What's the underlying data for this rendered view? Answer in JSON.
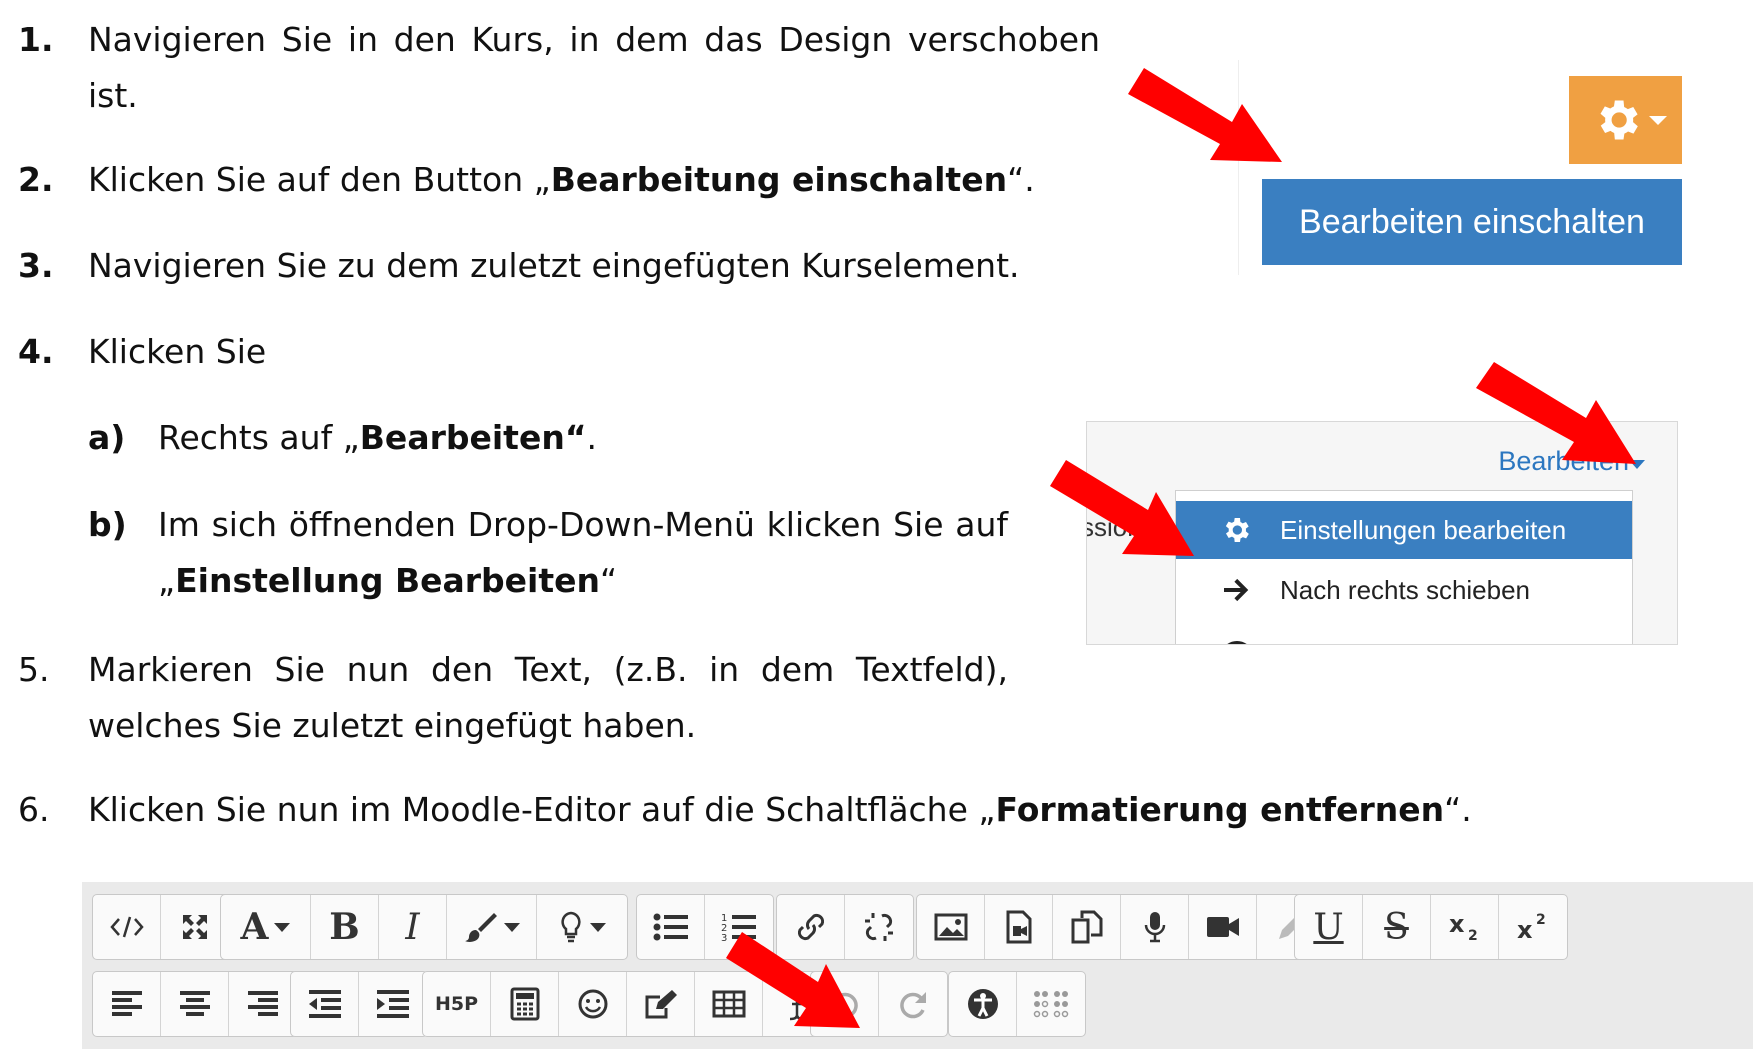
{
  "steps": [
    {
      "num": "1.",
      "text": "Navigieren Sie in den Kurs, in dem das Design verschoben ist."
    },
    {
      "num": "2.",
      "pre": "Klicken Sie auf den Button „",
      "bold": "Bearbeitung einschalten",
      "post": "“."
    },
    {
      "num": "3.",
      "text": "Navigieren Sie zu dem zuletzt eingefügten Kurselement."
    },
    {
      "num": "4.",
      "text": "Klicken Sie"
    },
    {
      "num": "a)",
      "pre": "Rechts auf „",
      "bold": "Bearbeiten“",
      "post": "."
    },
    {
      "num": "b)",
      "pre": "Im sich öffnenden Drop-Down-Menü klicken Sie auf „",
      "bold": "Einstellung Bearbeiten",
      "post": "“"
    },
    {
      "num": "5.",
      "text": "Markieren Sie nun den Text, (z.B. in dem Textfeld), welches Sie zuletzt eingefügt haben."
    },
    {
      "num": "6.",
      "pre": "Klicken Sie nun im Moodle-Editor auf die Schaltfläche „",
      "bold": "Formatierung entfernen",
      "post": "“."
    }
  ],
  "screenshot1": {
    "edit_button_label": "Bearbeiten einschalten",
    "gear_icon": "gear-icon",
    "colors": {
      "gear_bg": "#f0a042",
      "button_bg": "#3a7fc1"
    }
  },
  "screenshot2": {
    "link_label": "Bearbeiten",
    "partial_text": "ssion.",
    "menu_items": [
      {
        "label": "Einstellungen bearbeiten",
        "icon": "gear-icon",
        "active": true
      },
      {
        "label": "Nach rechts schieben",
        "icon": "arrow-right-icon",
        "active": false
      }
    ],
    "colors": {
      "link": "#2c77c0",
      "active_bg": "#3a7fc1"
    }
  },
  "toolbar": {
    "row1_groups": [
      [
        "html-icon",
        "fullscreen-icon"
      ],
      [
        "font-icon",
        "bold-icon",
        "italic-icon",
        "brush-icon",
        "lightbulb-icon"
      ],
      [
        "bullet-list-icon",
        "numbered-list-icon"
      ],
      [
        "link-icon",
        "unlink-icon"
      ],
      [
        "image-icon",
        "media-icon",
        "manage-files-icon",
        "microphone-icon",
        "video-icon",
        "pencil-icon"
      ],
      [
        "underline-icon",
        "strikethrough-icon",
        "subscript-icon",
        "superscript-icon"
      ]
    ],
    "row2_groups": [
      [
        "align-left-icon",
        "align-center-icon",
        "align-right-icon"
      ],
      [
        "outdent-icon",
        "indent-icon"
      ],
      [
        "h5p-icon",
        "calculator-icon",
        "emoji-icon",
        "edit-icon",
        "table-icon",
        "clear-formatting-icon"
      ],
      [
        "undo-icon",
        "redo-icon"
      ],
      [
        "accessibility-icon",
        "braille-icon"
      ]
    ],
    "labels": {
      "bold": "B",
      "italic": "I",
      "underline": "U",
      "strike": "S",
      "h5p": "H5P"
    }
  }
}
